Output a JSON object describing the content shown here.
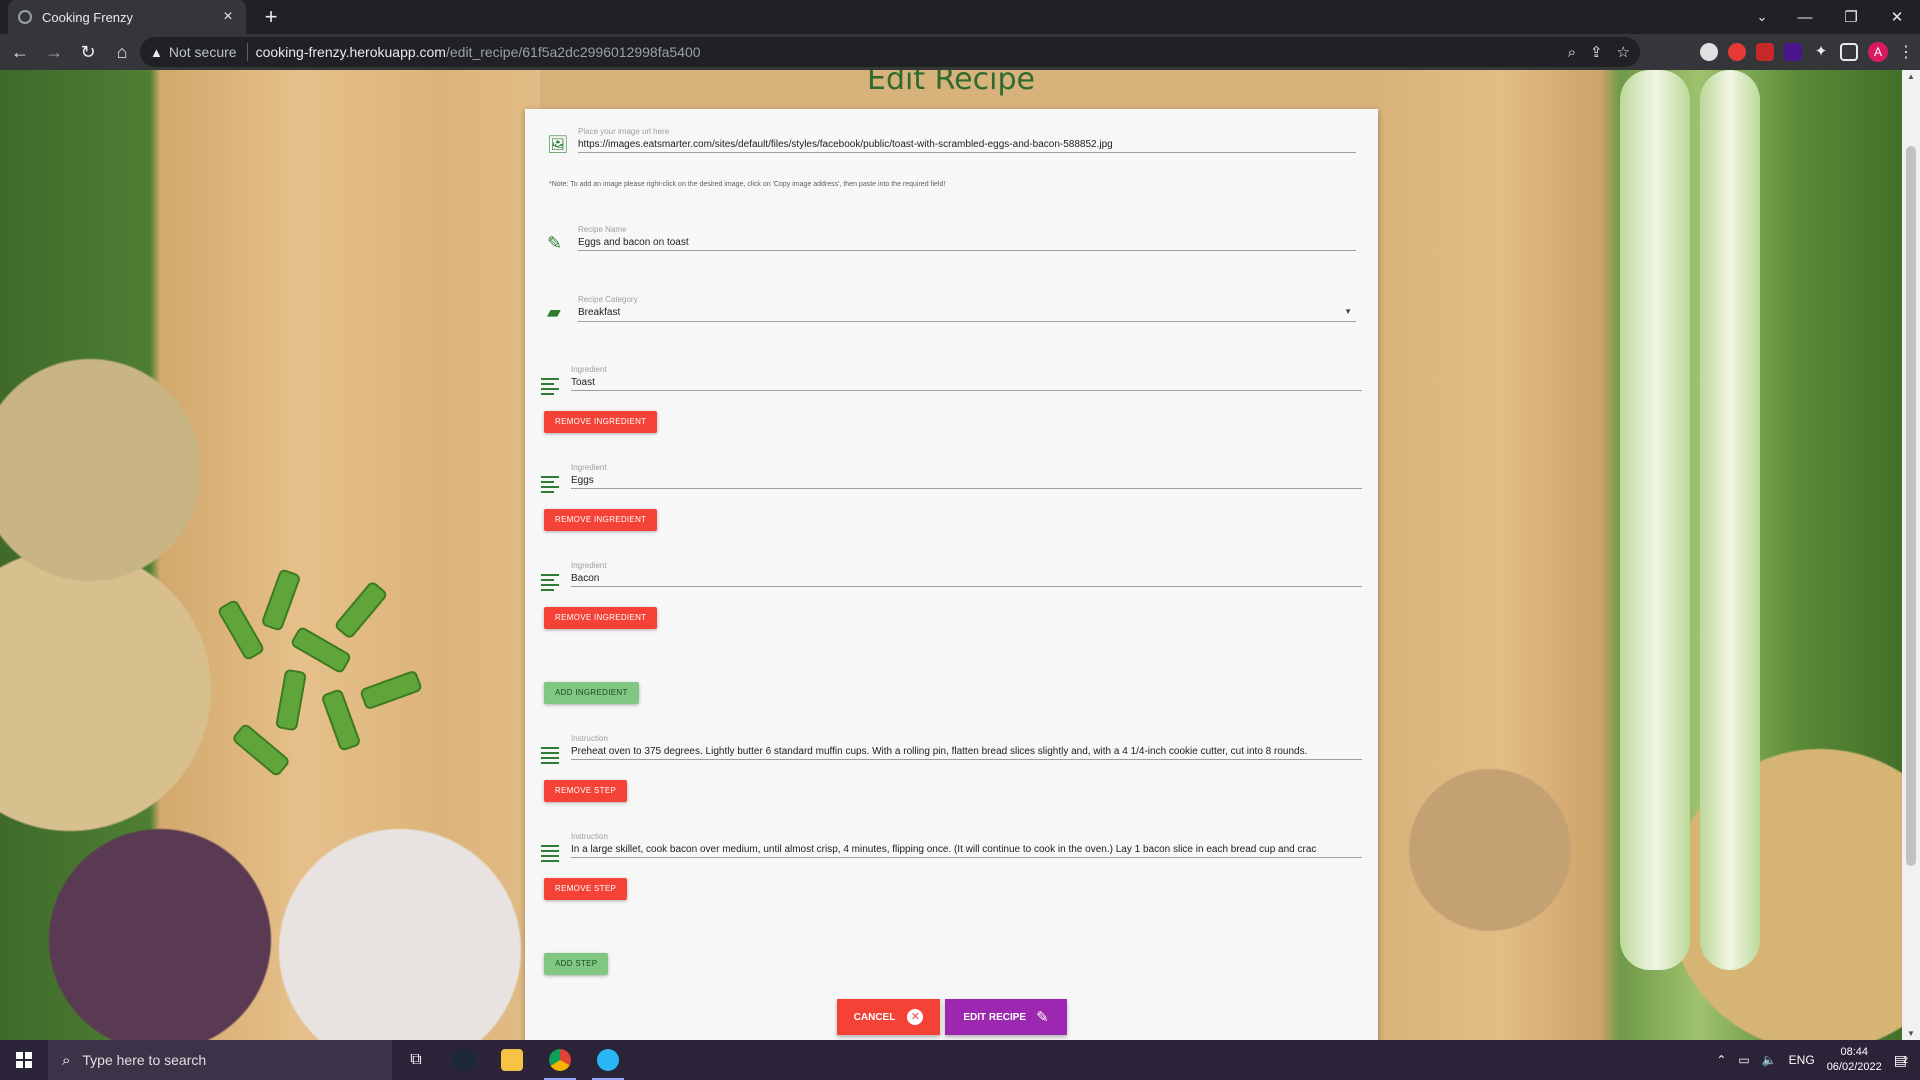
{
  "browser": {
    "tab_title": "Cooking Frenzy",
    "tab_close": "×",
    "new_tab": "+",
    "security_label": "Not secure",
    "url_host": "cooking-frenzy.herokuapp.com",
    "url_path": "/edit_recipe/61f5a2dc2996012998fa5400",
    "profile_initial": "A"
  },
  "page": {
    "title": "Edit Recipe",
    "image_field": {
      "label": "Place your image url here",
      "value": "https://images.eatsmarter.com/sites/default/files/styles/facebook/public/toast-with-scrambled-eggs-and-bacon-588852.jpg"
    },
    "note": "*Note: To add an image please right-click on the desired image, click on 'Copy image address', then paste into the required field!",
    "name_field": {
      "label": "Recipe Name",
      "value": "Eggs and bacon on toast"
    },
    "category_field": {
      "label": "Recipe Category",
      "value": "Breakfast"
    },
    "ingredients": [
      {
        "label": "Ingredient",
        "value": "Toast",
        "remove_label": "REMOVE INGREDIENT"
      },
      {
        "label": "Ingredient",
        "value": "Eggs",
        "remove_label": "REMOVE INGREDIENT"
      },
      {
        "label": "Ingredient",
        "value": "Bacon",
        "remove_label": "REMOVE INGREDIENT"
      }
    ],
    "add_ingredient_label": "ADD INGREDIENT",
    "steps": [
      {
        "label": "Instruction",
        "value": "Preheat oven to 375 degrees. Lightly butter 6 standard muffin cups. With a rolling pin, flatten bread slices slightly and, with a 4 1/4-inch cookie cutter, cut into 8 rounds.",
        "remove_label": "REMOVE STEP"
      },
      {
        "label": "Instruction",
        "value": "In a large skillet, cook bacon over medium, until almost crisp, 4 minutes, flipping once. (It will continue to cook in the oven.) Lay 1 bacon slice in each bread cup and crac",
        "remove_label": "REMOVE STEP"
      }
    ],
    "add_step_label": "ADD STEP",
    "cancel_label": "CANCEL",
    "edit_label": "EDIT RECIPE"
  },
  "taskbar": {
    "search_placeholder": "Type here to search",
    "language": "ENG",
    "time": "08:44",
    "date": "06/02/2022",
    "notifications": "2"
  },
  "colors": {
    "title_green": "#2e6b2e",
    "remove_red": "#f44336",
    "add_green": "#81c784",
    "edit_purple": "#9c27b0"
  }
}
